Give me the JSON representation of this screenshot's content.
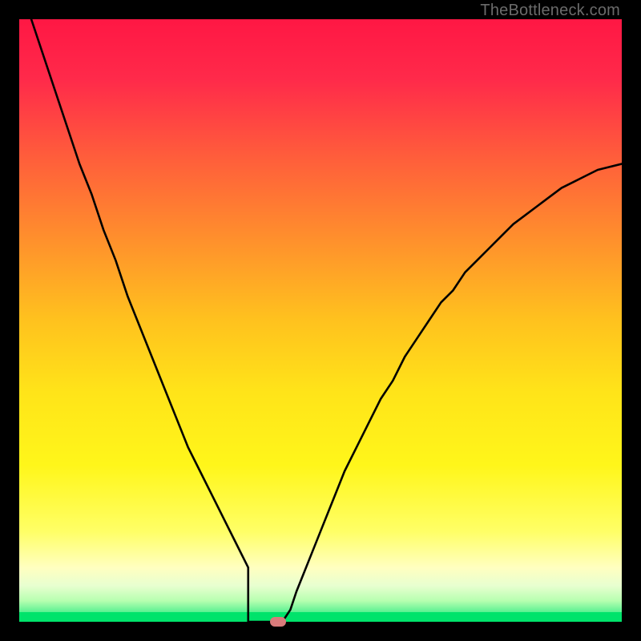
{
  "watermark": {
    "text": "TheBottleneck.com"
  },
  "colors": {
    "curve": "#000000",
    "flatband": "#00e36b",
    "marker": "#d97b7b",
    "gradient_stops": [
      {
        "offset": 0.0,
        "color": "#ff1744"
      },
      {
        "offset": 0.1,
        "color": "#ff2a4a"
      },
      {
        "offset": 0.22,
        "color": "#ff5a3c"
      },
      {
        "offset": 0.35,
        "color": "#ff8a2e"
      },
      {
        "offset": 0.5,
        "color": "#ffc21e"
      },
      {
        "offset": 0.62,
        "color": "#ffe419"
      },
      {
        "offset": 0.74,
        "color": "#fff61a"
      },
      {
        "offset": 0.85,
        "color": "#ffff66"
      },
      {
        "offset": 0.91,
        "color": "#ffffc0"
      },
      {
        "offset": 0.94,
        "color": "#e8ffd0"
      },
      {
        "offset": 0.965,
        "color": "#b7ffb0"
      },
      {
        "offset": 0.985,
        "color": "#55f090"
      },
      {
        "offset": 1.0,
        "color": "#00e36b"
      }
    ]
  },
  "chart_data": {
    "type": "line",
    "title": "",
    "xlabel": "",
    "ylabel": "",
    "xlim": [
      0,
      100
    ],
    "ylim": [
      0,
      100
    ],
    "x": [
      2,
      4,
      6,
      8,
      10,
      12,
      14,
      16,
      18,
      20,
      22,
      24,
      26,
      28,
      30,
      32,
      34,
      36,
      38,
      39,
      40,
      41,
      42,
      43,
      44,
      45,
      46,
      48,
      50,
      52,
      54,
      56,
      58,
      60,
      62,
      64,
      66,
      68,
      70,
      72,
      74,
      76,
      78,
      80,
      82,
      84,
      86,
      88,
      90,
      92,
      94,
      96,
      98,
      100
    ],
    "values": [
      100,
      94,
      88,
      82,
      76,
      71,
      65,
      60,
      54,
      49,
      44,
      39,
      34,
      29,
      25,
      21,
      17,
      13,
      9,
      6,
      4,
      2,
      0.5,
      0,
      0.5,
      2,
      5,
      10,
      15,
      20,
      25,
      29,
      33,
      37,
      40,
      44,
      47,
      50,
      53,
      55,
      58,
      60,
      62,
      64,
      66,
      67.5,
      69,
      70.5,
      72,
      73,
      74,
      75,
      75.5,
      76
    ],
    "flat_segment": {
      "x_start": 38,
      "x_end": 43,
      "y": 0
    },
    "marker": {
      "x": 43,
      "y": 0
    }
  }
}
